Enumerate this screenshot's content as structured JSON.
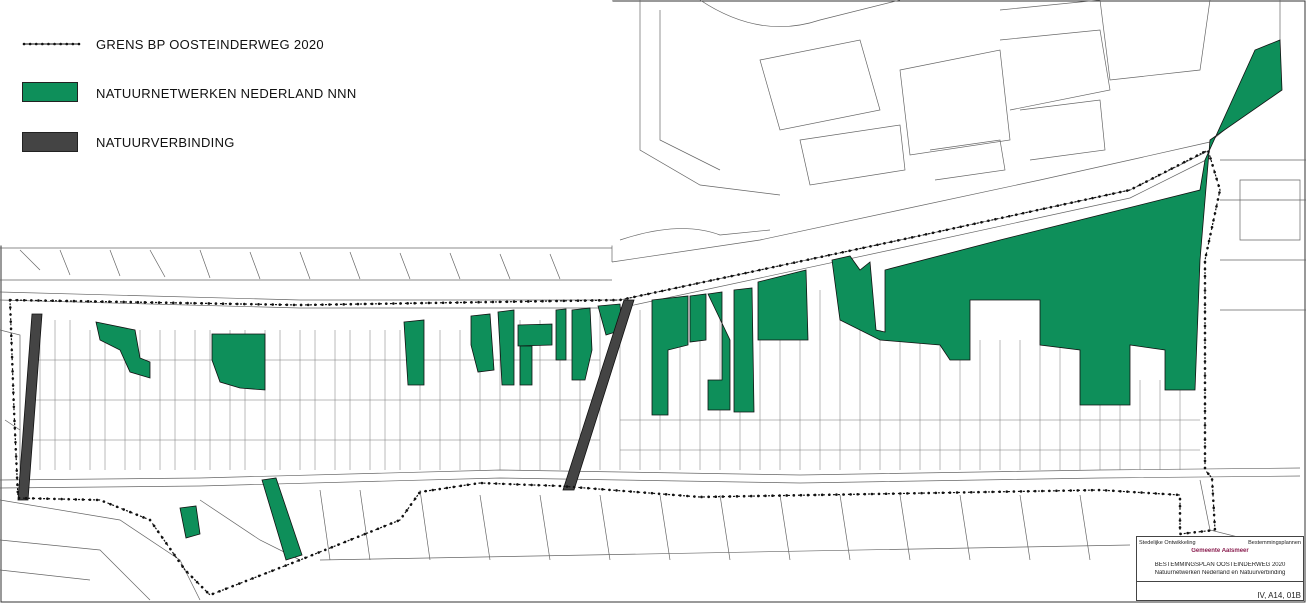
{
  "legend": {
    "grens": {
      "label": "GRENS BP OOSTEINDERWEG 2020"
    },
    "nnn": {
      "label": "NATUURNETWERKEN NEDERLAND NNN",
      "color": "#0e8f5a"
    },
    "verbinding": {
      "label": "NATUURVERBINDING",
      "color": "#444444"
    }
  },
  "titleblock": {
    "dept": "Stedelijke Ontwikkeling",
    "type": "Bestemmingsplannen",
    "municipality": "Gemeente Aalsmeer",
    "plan": "BESTEMMINGSPLAN OOSTEINDERWEG 2020",
    "subject": "Natuurnetwerken Nederland en Natuurverbinding",
    "sheet": "IV, A14, 01B"
  },
  "colors": {
    "line": "#555555",
    "green": "#0e8f5a",
    "dark": "#444444"
  }
}
